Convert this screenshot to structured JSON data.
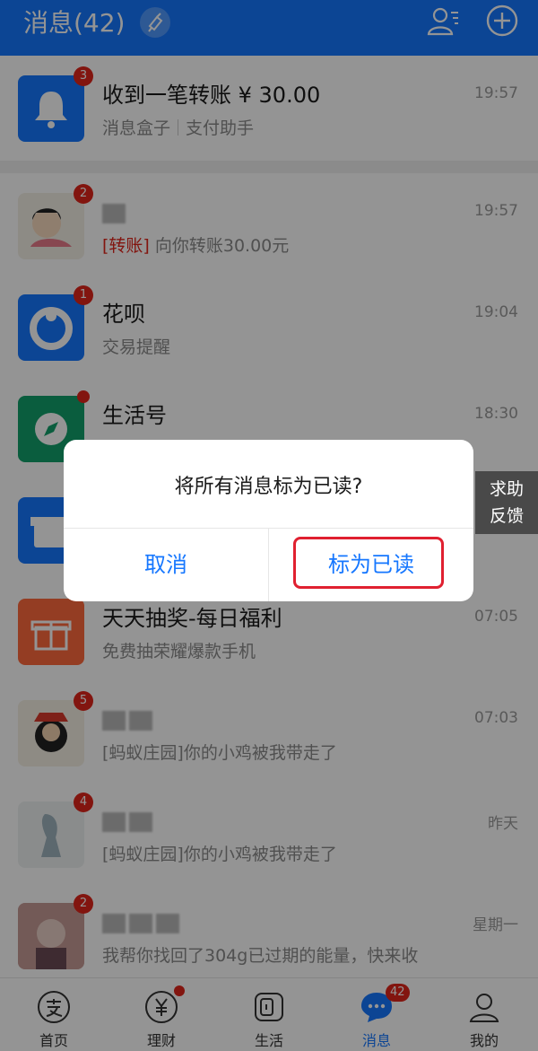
{
  "header": {
    "title": "消息(42)"
  },
  "top_item": {
    "title": "收到一笔转账 ¥ 30.00",
    "sub_a": "消息盒子",
    "sub_b": "支付助手",
    "time": "19:57",
    "badge": "3"
  },
  "items": [
    {
      "tag": "[转账]",
      "sub": "向你转账30.00元",
      "time": "19:57",
      "badge": "2"
    },
    {
      "title": "花呗",
      "sub": "交易提醒",
      "time": "19:04",
      "badge": "1"
    },
    {
      "title": "生活号",
      "time": "18:30"
    },
    {
      "title": "天天抽奖-每日福利",
      "sub": "免费抽荣耀爆款手机",
      "time": "07:05"
    },
    {
      "sub": "[蚂蚁庄园]你的小鸡被我带走了",
      "time": "07:03",
      "badge": "5"
    },
    {
      "sub": "[蚂蚁庄园]你的小鸡被我带走了",
      "time": "昨天",
      "badge": "4"
    },
    {
      "sub": "我帮你找回了304g已过期的能量，快来收",
      "time": "星期一",
      "badge": "2"
    }
  ],
  "tabs": [
    {
      "label": "首页"
    },
    {
      "label": "理财"
    },
    {
      "label": "生活"
    },
    {
      "label": "消息",
      "badge": "42"
    },
    {
      "label": "我的"
    }
  ],
  "help": {
    "line1": "求助",
    "line2": "反馈"
  },
  "dialog": {
    "message": "将所有消息标为已读?",
    "cancel": "取消",
    "confirm": "标为已读"
  },
  "colors": {
    "brand": "#1677ff",
    "badge": "#e1251b",
    "highlight_frame": "#e02030"
  }
}
